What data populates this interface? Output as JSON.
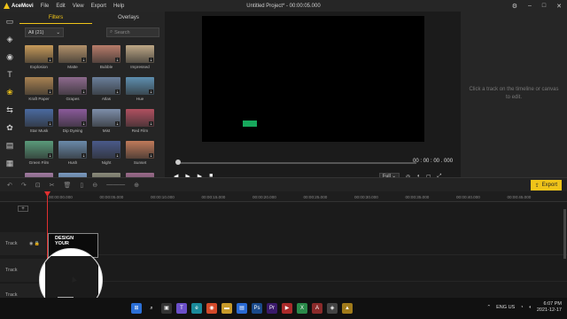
{
  "app": {
    "name": "AceMovi",
    "title": "Untitled Project* - 00:00:05.000",
    "menu": [
      "File",
      "Edit",
      "View",
      "Export",
      "Help"
    ]
  },
  "leftbar": {
    "icons": [
      "media-icon",
      "layers-icon",
      "audio-icon",
      "text-icon",
      "filters-icon",
      "transitions-icon",
      "elements-icon",
      "split-screen-icon",
      "grid-icon"
    ]
  },
  "panel": {
    "tabs": [
      "Filters",
      "Overlays"
    ],
    "active_tab": "Filters",
    "dropdown_value": "All (21)",
    "search_placeholder": "Search",
    "filters": [
      {
        "label": "Explosion",
        "color": "#c79a5a"
      },
      {
        "label": "Matte",
        "color": "#b2916a"
      },
      {
        "label": "Bubble",
        "color": "#b87c6a"
      },
      {
        "label": "Impressed",
        "color": "#bea886"
      },
      {
        "label": "Kraft Paper",
        "color": "#a98252"
      },
      {
        "label": "Grapes",
        "color": "#8d6a8d"
      },
      {
        "label": "Atlas",
        "color": "#6a7e9a"
      },
      {
        "label": "Hue",
        "color": "#5e8fb0"
      },
      {
        "label": "Star Musk",
        "color": "#4a6aa0"
      },
      {
        "label": "Dip Dyeing",
        "color": "#8a5a9a"
      },
      {
        "label": "Mist",
        "color": "#7d8eaa"
      },
      {
        "label": "Red Film",
        "color": "#b05060"
      },
      {
        "label": "Green Film",
        "color": "#5a9a7a"
      },
      {
        "label": "Hush",
        "color": "#6a8aaa"
      },
      {
        "label": "Night",
        "color": "#4a5a8a"
      },
      {
        "label": "Sunset",
        "color": "#c07a5a"
      },
      {
        "label": "",
        "color": "#a07aa0"
      },
      {
        "label": "",
        "color": "#7a9ac0"
      },
      {
        "label": "",
        "color": "#8a8a7a"
      },
      {
        "label": "",
        "color": "#9a6a8a"
      }
    ]
  },
  "preview": {
    "timecode": "00 : 00 : 00 . 000",
    "resolution": "Full"
  },
  "properties": {
    "hint": "Click a track on the timeline or canvas to edit."
  },
  "toolbar": {
    "export_label": "Export"
  },
  "timeline": {
    "ticks": [
      "00:00:00.000",
      "00:00:05.000",
      "00:00:10.000",
      "00:00:15.000",
      "00:00:20.000",
      "00:00:25.000",
      "00:00:30.000",
      "00:00:35.000",
      "00:00:40.000",
      "00:00:45.000"
    ],
    "track_label": "Track",
    "clip_text": [
      "DESIGN",
      "YOUR"
    ]
  },
  "taskbar": {
    "lang": "ENG",
    "region": "US",
    "time": "6:07 PM",
    "date": "2021-12-17"
  },
  "colors": {
    "accent": "#f0c419",
    "playhead": "#e03030",
    "green_element": "#17a85c"
  }
}
